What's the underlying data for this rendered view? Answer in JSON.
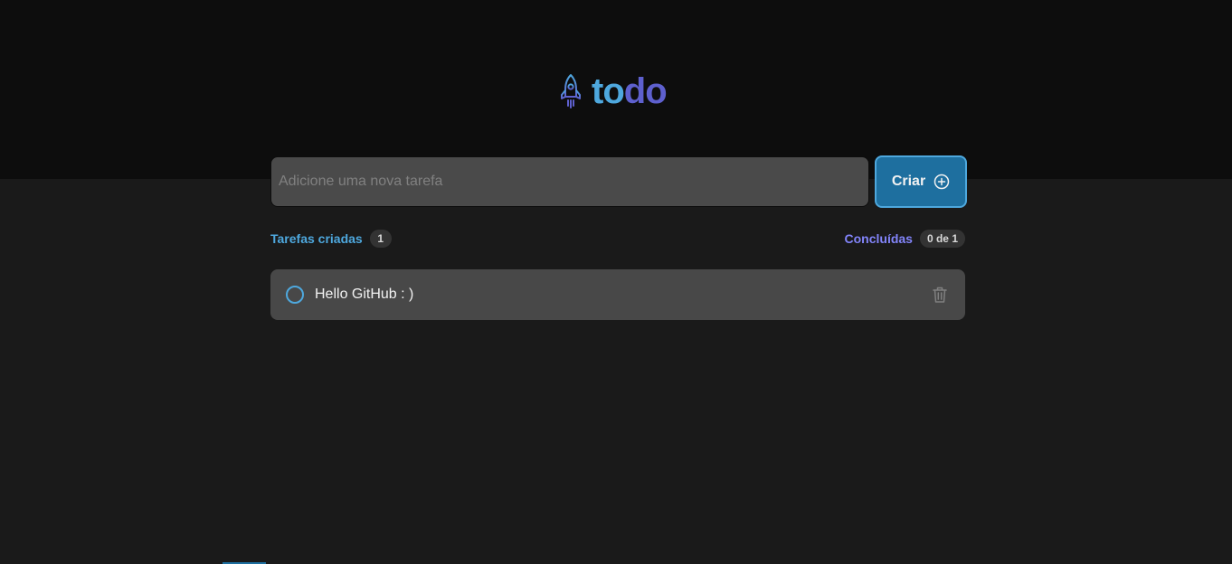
{
  "header": {
    "logo_icon": "rocket-icon",
    "logo_text_part1": "to",
    "logo_text_part2": "do"
  },
  "form": {
    "input_placeholder": "Adicione uma nova tarefa",
    "input_value": "",
    "create_label": "Criar",
    "create_icon": "plus-circle-icon"
  },
  "info": {
    "created_label": "Tarefas criadas",
    "created_count": "1",
    "done_label": "Concluídas",
    "done_count": "0 de 1"
  },
  "tasks": [
    {
      "text": "Hello GitHub : )",
      "completed": false
    }
  ],
  "colors": {
    "blue": "#4ea8de",
    "blue_dark": "#1e6f9f",
    "purple": "#8284fa",
    "purple_dark": "#5e60ce",
    "header_bg": "#0d0d0d",
    "body_bg": "#1a1a1a",
    "card_bg": "#484848"
  }
}
